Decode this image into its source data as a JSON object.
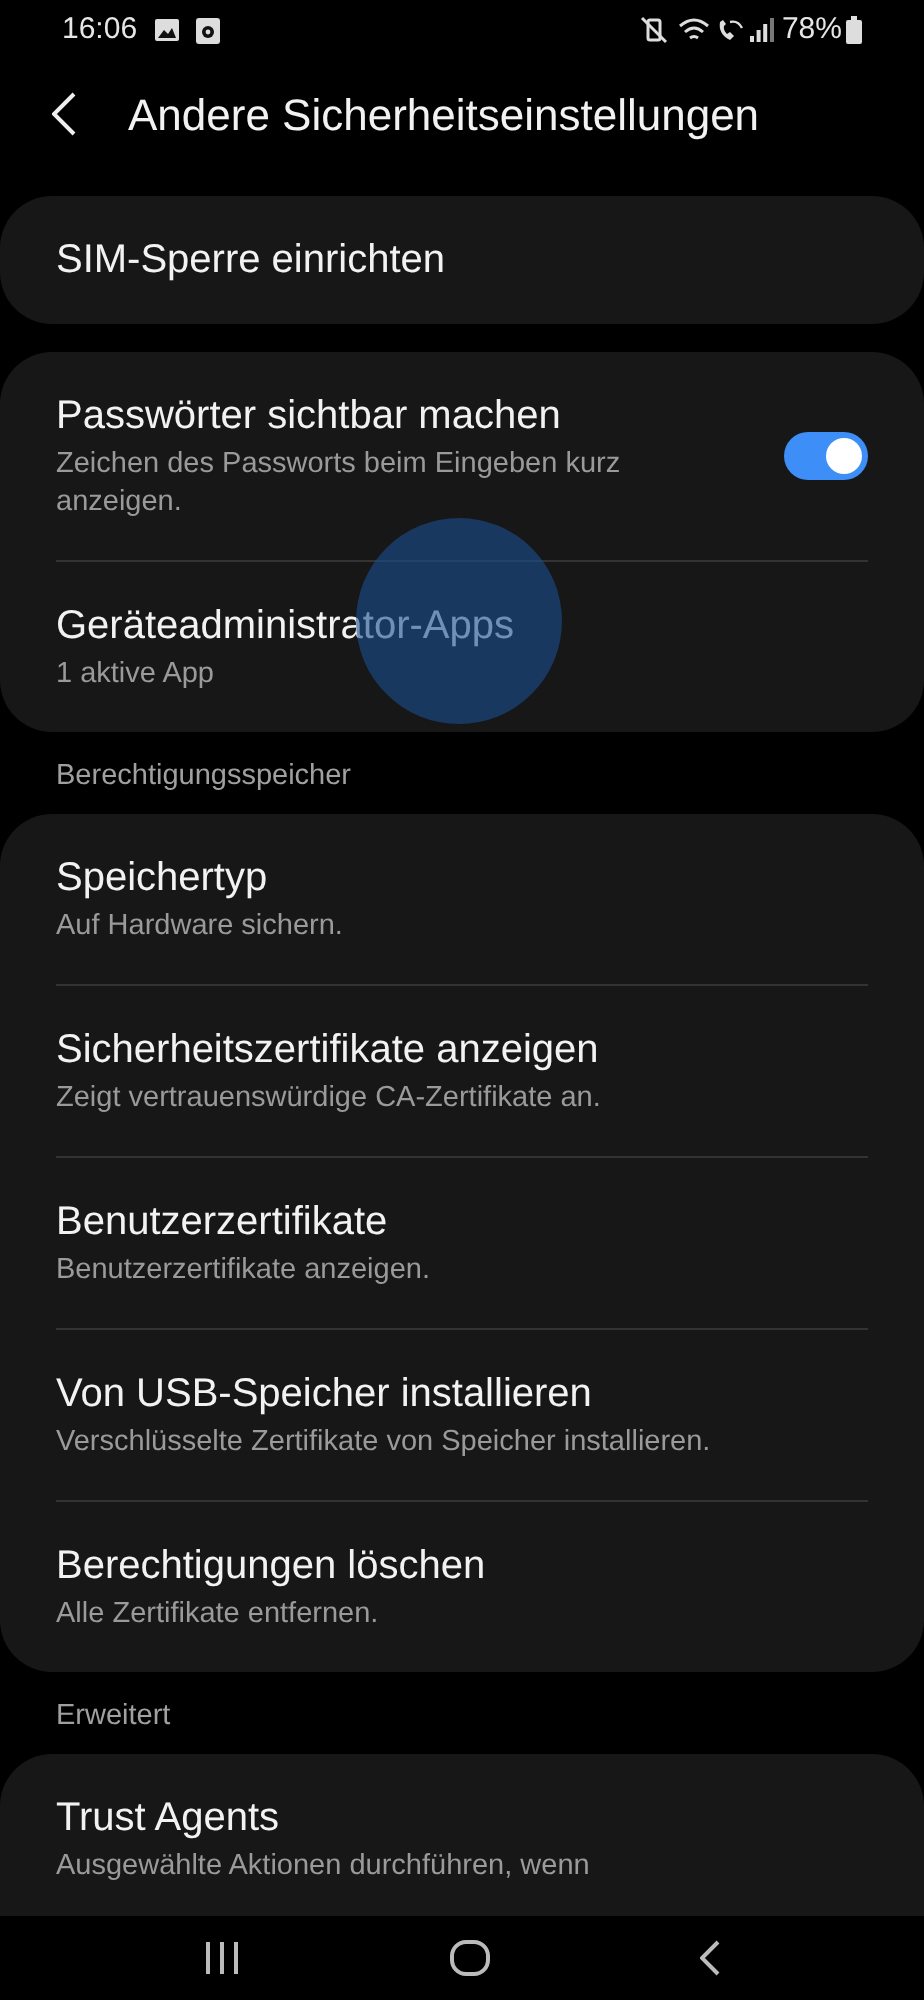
{
  "status_bar": {
    "time": "16:06",
    "battery": "78%"
  },
  "header": {
    "title": "Andere Sicherheitseinstellungen"
  },
  "groups": [
    {
      "kind": "card",
      "items": [
        {
          "title": "SIM-Sperre einrichten"
        }
      ]
    },
    {
      "kind": "card",
      "items": [
        {
          "title": "Passwörter sichtbar machen",
          "subtitle": "Zeichen des Passworts beim Eingeben kurz anzeigen.",
          "toggle": {
            "on": true
          }
        },
        {
          "title": "Geräteadministrator-Apps",
          "subtitle": "1 aktive App",
          "touched": true
        }
      ]
    },
    {
      "kind": "section",
      "label": "Berechtigungsspeicher"
    },
    {
      "kind": "card",
      "items": [
        {
          "title": "Speichertyp",
          "subtitle": "Auf Hardware sichern."
        },
        {
          "title": "Sicherheitszertifikate anzeigen",
          "subtitle": "Zeigt vertrauenswürdige CA-Zertifikate an."
        },
        {
          "title": "Benutzerzertifikate",
          "subtitle": "Benutzerzertifikate anzeigen."
        },
        {
          "title": "Von USB-Speicher installieren",
          "subtitle": "Verschlüsselte Zertifikate von Speicher installieren."
        },
        {
          "title": "Berechtigungen löschen",
          "subtitle": "Alle Zertifikate entfernen."
        }
      ]
    },
    {
      "kind": "section",
      "label": "Erweitert"
    },
    {
      "kind": "card",
      "items": [
        {
          "title": "Trust Agents",
          "subtitle": "Ausgewählte Aktionen durchführen, wenn"
        }
      ]
    }
  ]
}
